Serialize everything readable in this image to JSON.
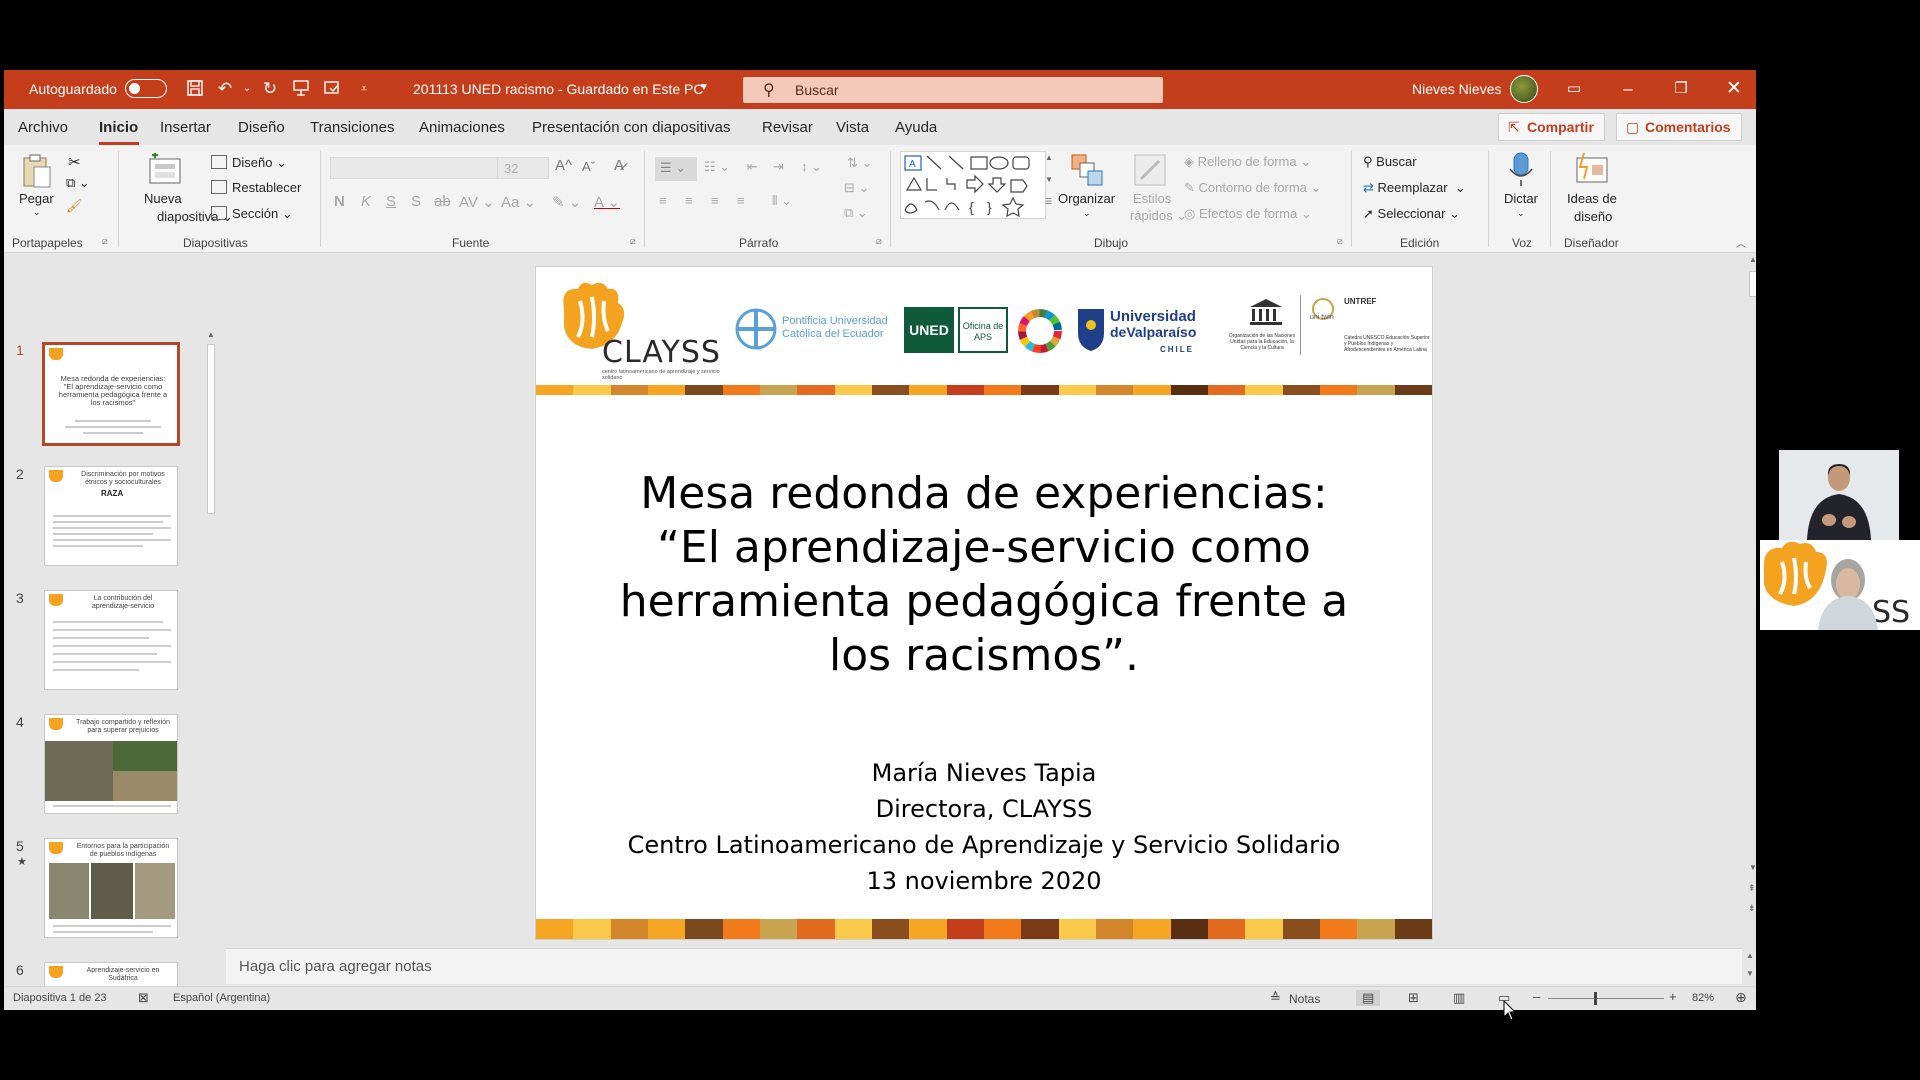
{
  "titlebar": {
    "autosave_label": "Autoguardado",
    "document_title": "201113 UNED racismo - Guardado en Este PC",
    "search_placeholder": "Buscar",
    "user_name": "Nieves Nieves"
  },
  "menu": {
    "tabs": [
      {
        "label": "Archivo"
      },
      {
        "label": "Inicio"
      },
      {
        "label": "Insertar"
      },
      {
        "label": "Diseño"
      },
      {
        "label": "Transiciones"
      },
      {
        "label": "Animaciones"
      },
      {
        "label": "Presentación con diapositivas"
      },
      {
        "label": "Revisar"
      },
      {
        "label": "Vista"
      },
      {
        "label": "Ayuda"
      }
    ],
    "share_label": "Compartir",
    "comments_label": "Comentarios"
  },
  "ribbon": {
    "clipboard": {
      "paste": "Pegar",
      "group": "Portapapeles"
    },
    "slides": {
      "new_slide_1": "Nueva",
      "new_slide_2": "diapositiva",
      "layout": "Diseño",
      "reset": "Restablecer",
      "section": "Sección",
      "group": "Diapositivas"
    },
    "font": {
      "size": "32",
      "group": "Fuente"
    },
    "paragraph": {
      "group": "Párrafo"
    },
    "drawing": {
      "arrange": "Organizar",
      "quick_styles_1": "Estilos",
      "quick_styles_2": "rápidos",
      "shape_fill": "Relleno de forma",
      "shape_outline": "Contorno de forma",
      "shape_effects": "Efectos de forma",
      "group": "Dibujo"
    },
    "editing": {
      "find": "Buscar",
      "replace": "Reemplazar",
      "select": "Seleccionar",
      "group": "Edición"
    },
    "voice": {
      "dictate": "Dictar",
      "group": "Voz"
    },
    "designer": {
      "ideas_1": "Ideas de",
      "ideas_2": "diseño",
      "group": "Diseñador"
    }
  },
  "thumbnails": [
    {
      "num": "1",
      "title": "Mesa redonda de experiencias: \"El aprendizaje-servicio como herramienta pedagógica frente a los racismos\""
    },
    {
      "num": "2",
      "title": "Discriminación por motivos étnicos y socioculturales"
    },
    {
      "num": "3",
      "title": "La contribución del aprendizaje-servicio"
    },
    {
      "num": "4",
      "title": "Trabajo compartido y reflexión para superar prejuicios"
    },
    {
      "num": "5",
      "title": "Entornos para la participación de pueblos indígenas"
    },
    {
      "num": "6",
      "title": "Aprendizaje-servicio en Sudáfrica"
    }
  ],
  "slide": {
    "logo_clayss": "CLAYSS",
    "logo_clayss_sub": "centro latinoamericano de aprendizaje y servicio solidario",
    "logo_puce": "Pontificia Universidad Católica del Ecuador",
    "logo_uned": "UNED",
    "logo_aps": "Oficina de APS",
    "logo_uv_1": "Universidad",
    "logo_uv_2": "deValparaíso",
    "logo_uv_3": "CHILE",
    "logo_unesco": "Organización de las Naciones Unidas para la Educación, la Ciencia y la Cultura",
    "logo_untref": "UNTREF",
    "logo_untref_sub": "Cátedra UNESCO Educación Superior y Pueblos Indígenas y Afrodescendientes en América Latina",
    "title_lines": [
      "Mesa redonda de experiencias:",
      "“El aprendizaje-servicio como",
      "herramienta pedagógica frente a",
      "los racismos”."
    ],
    "subtitle_lines": [
      "María Nieves Tapia",
      "Directora, CLAYSS",
      "Centro Latinoamericano de Aprendizaje y Servicio Solidario",
      "13 noviembre 2020"
    ],
    "stripe_colors": [
      "#f6a623",
      "#fbc94a",
      "#d4862a",
      "#f6a623",
      "#7a4a1e",
      "#f27a1a",
      "#c9a450",
      "#e36a1e",
      "#fbc94a",
      "#8a4e1e",
      "#f6a623",
      "#c43e1c",
      "#f27a1a",
      "#7a3a16",
      "#fbc94a",
      "#d4862a",
      "#f6a623",
      "#5a2e12",
      "#e36a1e",
      "#fbc94a",
      "#8a4e1e",
      "#f27a1a",
      "#c9a450",
      "#6b3b18"
    ]
  },
  "notes_placeholder": "Haga clic para agregar notas",
  "status": {
    "slide_info": "Diapositiva 1 de 23",
    "language": "Español (Argentina)",
    "notes_label": "Notas",
    "zoom": "82%"
  },
  "colors": {
    "accent": "#c43e1c",
    "ribbon_bg": "#f3f3f3",
    "workspace_bg": "#e6e6e6"
  },
  "icons": [
    "save-icon",
    "undo-icon",
    "redo-icon",
    "present-icon",
    "search-icon",
    "minimize-icon",
    "restore-icon",
    "close-icon",
    "paste-icon",
    "dictate-icon"
  ]
}
